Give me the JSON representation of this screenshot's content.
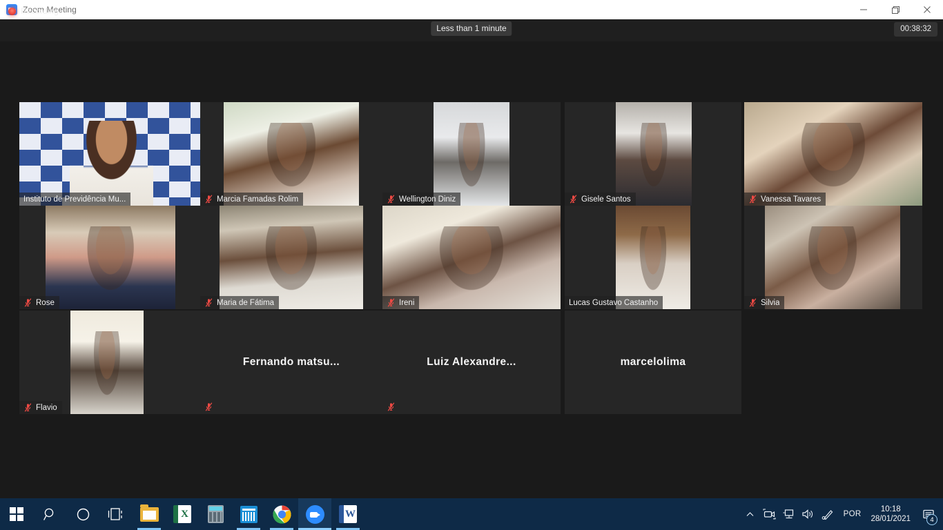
{
  "window": {
    "title": "Zoom Meeting",
    "app_icon": "zoom-video-icon",
    "controls": {
      "minimize": "minimize-icon",
      "restore": "restore-icon",
      "close": "close-icon"
    }
  },
  "topbar": {
    "recording_label": "Recording",
    "recording_dot": "record-dot-icon",
    "remaining_time": "Less than 1 minute",
    "elapsed_time": "00:38:32"
  },
  "colors": {
    "accent_blue": "#2d8cff",
    "active_speaker_border": "#d9e021",
    "mute_red": "#ef4a44",
    "stage_bg": "#1a1a1a",
    "tile_bg": "#262626",
    "taskbar_bg": "#0e2a47"
  },
  "participants": [
    {
      "name": "Instituto de Previdência Mu...",
      "muted": false,
      "has_video": true,
      "speaking": true,
      "row": 1,
      "col": 1
    },
    {
      "name": "Marcia Famadas Rolim",
      "muted": true,
      "has_video": true,
      "speaking": false,
      "row": 1,
      "col": 2
    },
    {
      "name": "Wellington Diniz",
      "muted": true,
      "has_video": true,
      "speaking": false,
      "row": 1,
      "col": 3
    },
    {
      "name": "Gisele Santos",
      "muted": true,
      "has_video": true,
      "speaking": false,
      "row": 1,
      "col": 4
    },
    {
      "name": "Vanessa Tavares",
      "muted": true,
      "has_video": true,
      "speaking": false,
      "row": 1,
      "col": 5
    },
    {
      "name": "Rose",
      "muted": true,
      "has_video": true,
      "speaking": false,
      "row": 2,
      "col": 1
    },
    {
      "name": "Maria de Fátima",
      "muted": true,
      "has_video": true,
      "speaking": false,
      "row": 2,
      "col": 2
    },
    {
      "name": "Ireni",
      "muted": true,
      "has_video": true,
      "speaking": false,
      "row": 2,
      "col": 3
    },
    {
      "name": "Lucas Gustavo Castanho",
      "muted": false,
      "has_video": true,
      "speaking": false,
      "row": 2,
      "col": 4
    },
    {
      "name": "Silvia",
      "muted": true,
      "has_video": true,
      "speaking": false,
      "row": 2,
      "col": 5
    },
    {
      "name": "Flavio",
      "muted": true,
      "has_video": true,
      "speaking": false,
      "row": 3,
      "col": 1
    },
    {
      "name": "Fernando matsu...",
      "muted": true,
      "has_video": false,
      "speaking": false,
      "row": 3,
      "col": 2
    },
    {
      "name": "Luiz Alexandre...",
      "muted": true,
      "has_video": false,
      "speaking": false,
      "row": 3,
      "col": 3
    },
    {
      "name": "marcelolima",
      "muted": false,
      "has_video": false,
      "speaking": false,
      "row": 3,
      "col": 4
    }
  ],
  "taskbar": {
    "items": [
      {
        "icon": "windows-start-icon",
        "state": "idle"
      },
      {
        "icon": "search-icon",
        "state": "idle"
      },
      {
        "icon": "cortana-circle-icon",
        "state": "idle"
      },
      {
        "icon": "task-view-icon",
        "state": "idle"
      },
      {
        "icon": "file-explorer-icon",
        "state": "open"
      },
      {
        "icon": "excel-icon",
        "state": "idle"
      },
      {
        "icon": "calculator-icon",
        "state": "idle"
      },
      {
        "icon": "calendar-icon",
        "state": "open"
      },
      {
        "icon": "chrome-icon",
        "state": "open"
      },
      {
        "icon": "zoom-icon",
        "state": "active"
      },
      {
        "icon": "word-icon",
        "state": "open"
      }
    ],
    "tray": {
      "overflow": "chevron-up-icon",
      "camera": "camera-icon",
      "network": "network-monitor-icon",
      "volume": "speaker-icon",
      "pen": "pen-icon",
      "language": "POR",
      "time": "10:18",
      "date": "28/01/2021",
      "notification_icon": "notification-icon",
      "notification_count": "4"
    }
  }
}
